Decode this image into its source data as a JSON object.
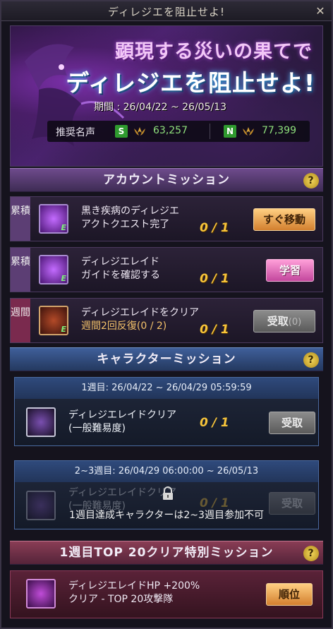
{
  "window": {
    "title": "ディレジエを阻止せよ!",
    "close_glyph": "✕"
  },
  "banner": {
    "headline1": "顕現する災いの果てで",
    "headline2": "ディレジエを阻止せよ!",
    "period": "期間 : 26/04/22 ~ 26/05/13",
    "renown_label": "推奨名声",
    "grade_s": "S",
    "value_s": "63,257",
    "grade_n": "N",
    "value_n": "77,399"
  },
  "account_section": {
    "title": "アカウントミッション",
    "help": "?",
    "missions": [
      {
        "tag": "累積",
        "line1": "黒き疾病のディレジエ",
        "line2": "アクトクエスト完了",
        "progress": "0 / 1",
        "button": "すぐ移動",
        "icon": "dark-orb-icon"
      },
      {
        "tag": "累積",
        "line1": "ディレジエレイド",
        "line2": "ガイドを確認する",
        "progress": "0 / 1",
        "button": "学習",
        "icon": "dark-orb-icon"
      },
      {
        "tag": "週間",
        "line1": "ディレジエレイドをクリア",
        "line2": "週間2回反復(0 / 2)",
        "progress": "0 / 1",
        "button": "受取",
        "button_count": "(0)",
        "icon": "chest-icon"
      }
    ]
  },
  "character_section": {
    "title": "キャラクターミッション",
    "help": "?",
    "week1": {
      "date": "1週目: 26/04/22 ~ 26/04/29 05:59:59",
      "line1": "ディレジエレイドクリア",
      "line2": "(一般難易度)",
      "progress": "0 / 1",
      "button": "受取"
    },
    "week23": {
      "date": "2~3週目: 26/04/29 06:00:00 ~ 26/05/13",
      "line1": "ディレジエレイドクリア",
      "line2": "(一般難易度)",
      "progress": "0 / 1",
      "button": "受取",
      "lock_text": "1週目達成キャラクターは2~3週目参加不可"
    }
  },
  "top20_section": {
    "title": "1週目TOP 20クリア特別ミッション",
    "help": "?",
    "line1": "ディレジエレイドHP +200%",
    "line2": "クリア - TOP 20攻撃隊",
    "button": "順位"
  }
}
